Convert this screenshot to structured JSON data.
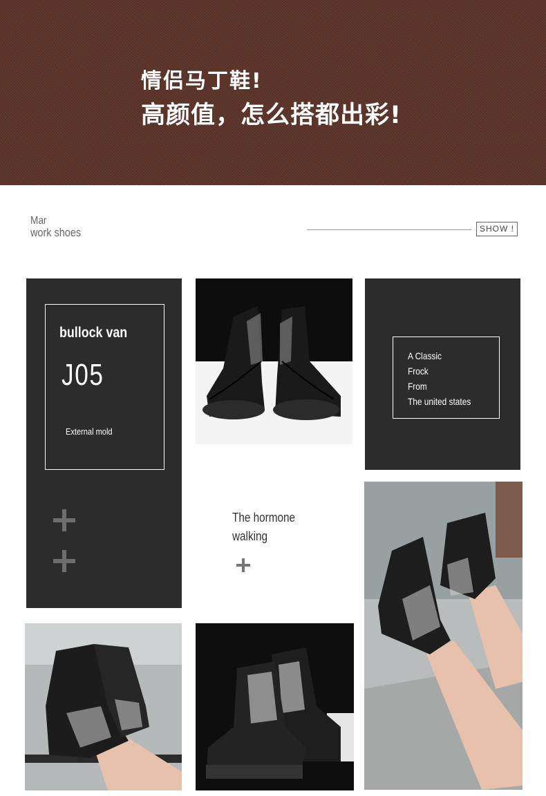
{
  "banner": {
    "line1": "情侣马丁鞋!",
    "line2": "高颜值，怎么搭都出彩!"
  },
  "section": {
    "title_small": "Mar",
    "title_main": "work shoes",
    "show_label": "SHOW !"
  },
  "panel_left": {
    "title": "bullock van",
    "code": "J05",
    "subtitle": "External mold"
  },
  "panel_right": {
    "lines": [
      "A Classic",
      "Frock",
      "From",
      "The united states"
    ]
  },
  "center_text": {
    "line1": "The hormone",
    "line2": "walking"
  },
  "colors": {
    "banner": "#5b3328",
    "panel": "#2c2c2c",
    "plus": "#6e6e6e"
  }
}
